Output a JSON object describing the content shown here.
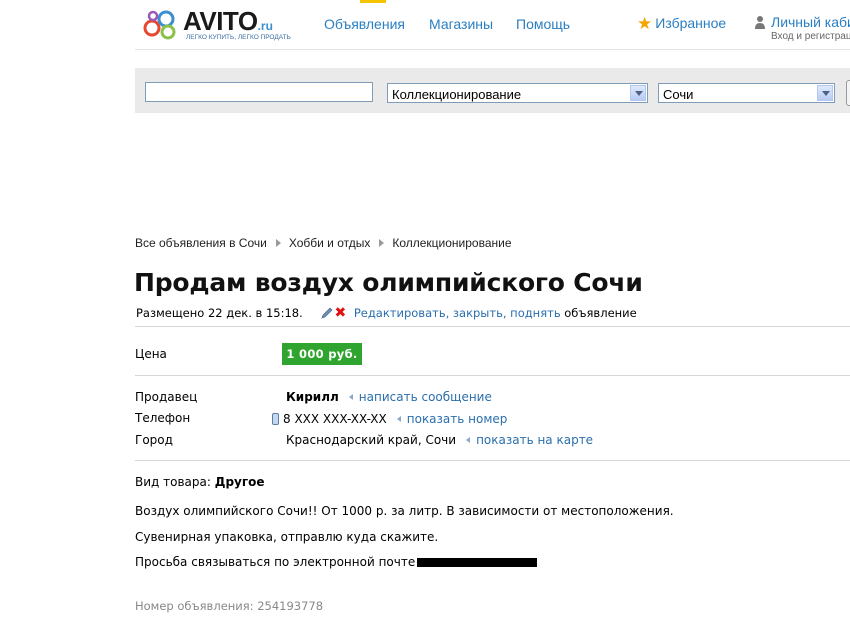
{
  "header": {
    "logo_text": "AVITO",
    "logo_suffix": ".ru",
    "logo_tagline": "ЛЕГКО КУПИТЬ, ЛЕГКО ПРОДАТЬ",
    "nav": [
      "Объявления",
      "Магазины",
      "Помощь"
    ],
    "favorites": "Избранное",
    "cabinet": "Личный каби",
    "cabinet_sub": "Вход и регистрац"
  },
  "search": {
    "query": "",
    "category": "Коллекционирование",
    "city": "Сочи"
  },
  "breadcrumbs": [
    "Все объявления в Сочи",
    "Хобби и отдых",
    "Коллекционирование"
  ],
  "ad": {
    "title": "Продам воздух олимпийского Сочи",
    "posted": "Размещено 22 дек. в 15:18.",
    "edit_link": "Редактировать, закрыть, поднять",
    "edit_suffix": "объявление",
    "price_label": "Цена",
    "price": "1 000 руб.",
    "seller_label": "Продавец",
    "seller": "Кирилл",
    "message_link": "написать сообщение",
    "phone_label": "Телефон",
    "phone": "8 XXX XXX-XX-XX",
    "show_number_link": "показать номер",
    "city_label": "Город",
    "city": "Краснодарский край, Сочи",
    "show_map_link": "показать на карте",
    "type_label": "Вид товара:",
    "type_value": "Другое",
    "description": [
      "Воздух олимпийского Сочи!! От 1000 р. за литр. В зависимости от местоположения.",
      "Сувенирная упаковка, отправлю куда скажите.",
      "Просьба связываться по электронной почте"
    ],
    "ad_number": "Номер объявления: 254193778"
  },
  "colors": {
    "link": "#2a7fc3",
    "price_bg": "#2fa52f",
    "delete": "#e01010",
    "star": "#f2a500"
  },
  "icons": [
    "avito-logo-icon",
    "star-icon",
    "user-icon",
    "dropdown-arrow-icon",
    "pencil-icon",
    "delete-icon",
    "phone-icon",
    "arrow-left-icon",
    "breadcrumb-arrow-icon"
  ]
}
